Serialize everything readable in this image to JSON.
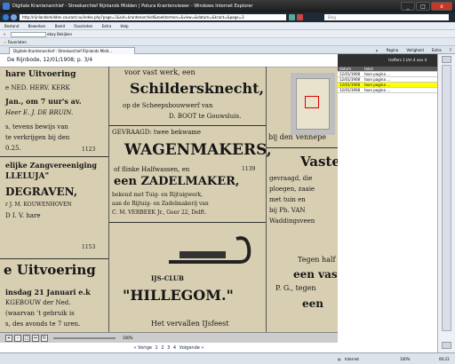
{
  "window": {
    "title": "Digitale Krantenarchief - Streekarchief Rijnlands Midden | Potura Krantenviewer - Windows Internet Explorer",
    "url": "http://rijnlandsmidden.courant.nu/index.php?page=1&sid=krantenarchief&zoektermen=&view=&datum=&krant=&page=3"
  },
  "search": {
    "placeholder": "Bing"
  },
  "menu": [
    "Bestand",
    "Bewerken",
    "Beeld",
    "Favorieten",
    "Extra",
    "Help"
  ],
  "toolbar": {
    "label": "ebay Bekijken"
  },
  "favorites": {
    "label": "Favorieten"
  },
  "tab": {
    "label": "Digitale Krantenarchief - Streekarchief Rijnlands Midd..."
  },
  "tools": [
    "Pagina",
    "Veiligheid",
    "Extra"
  ],
  "document": {
    "header": "De Rijnbode, 12/01/1908; p. 3/4"
  },
  "newspaper": {
    "c1": [
      "hare Uitvoering",
      "e NED. HERV. KERK",
      "Jan., om 7 uur's av.",
      "Heer E. J. DE BRUIN.",
      "s, tevens bewijs van",
      "te verkrijgen bij den",
      "0.25.",
      "1123",
      "elijke Zangvereeniging",
      "LLELUJA\"",
      "DEGRAVEN,",
      "r J. M. KOUWENHOVEN",
      "D I. V. hare",
      "1153",
      "e Uitvoering",
      "insdag 21 Januari e.k",
      "KGEBOUW der Ned.",
      "(waarvan 't gebruik is",
      "s, des avonds te 7 uren."
    ],
    "c2": [
      "voor vast werk, een",
      "Schildersknecht,",
      "op de Scheepsbouwwerf van",
      "D. BOOT te Gouwsluis.",
      "GEVRAAGD: twee bekwame",
      "WAGENMAKERS,",
      "of flinke Halfwassen, en",
      "1139",
      "een ZADELMAKER,",
      "bekend met Tuig- en Rijtuigwerk,",
      "aan de Rijtuig- en Zadelmakerij van",
      "C. M. VERBEEK Jr., Geer 22, Delft.",
      "IJS-CLUB",
      "\"HILLEGOM.\"",
      "Het vervallen IJsfeest"
    ],
    "c3": [
      "bij den Vennepe",
      "Vaste",
      "gevraagd, die",
      "ploegen, zaaie",
      "met tuin en",
      "bij Ph. VAN",
      "Waddingsveen",
      "Tegen half",
      "een vas",
      "P. G., tegen",
      "een"
    ]
  },
  "viewer": {
    "zoom": "100%"
  },
  "pager": {
    "prev": "« Vorige",
    "p1": "1",
    "p2": "2",
    "p3": "3",
    "p4": "4",
    "next": "Volgende »"
  },
  "results": {
    "summary": "treffers 1 t/m 4 van 4",
    "col_date": "datum",
    "col_text": "tekst",
    "rows": [
      {
        "date": "12/01/1908",
        "text": "toon pagina ..."
      },
      {
        "date": "12/01/1908",
        "text": "toon pagina ..."
      },
      {
        "date": "12/01/1908",
        "text": "toon pagina ..."
      },
      {
        "date": "12/01/1908",
        "text": "toon pagina ..."
      }
    ]
  },
  "status": {
    "zone": "Internet",
    "zoom": "100%"
  },
  "taskbar": {
    "time": "00:23"
  }
}
